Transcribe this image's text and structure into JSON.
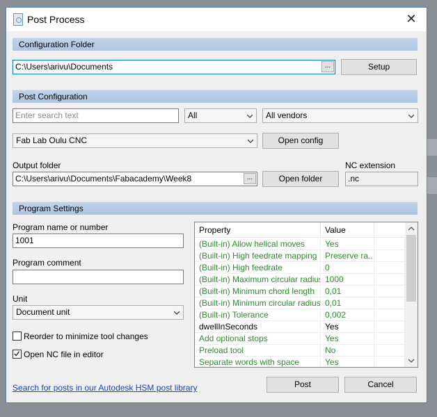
{
  "window": {
    "title": "Post Process"
  },
  "config_folder": {
    "header": "Configuration Folder",
    "path": "C:\\Users\\arivu\\Documents",
    "browse": "...",
    "setup_label": "Setup"
  },
  "post_config": {
    "header": "Post Configuration",
    "search_placeholder": "Enter search text",
    "filter_value": "All",
    "vendor_value": "All vendors",
    "post_value": "Fab Lab Oulu CNC",
    "open_config_label": "Open config",
    "output_folder_label": "Output folder",
    "output_path": "C:\\Users\\arivu\\Documents\\Fabacademy\\Week8",
    "browse": "...",
    "open_folder_label": "Open folder",
    "nc_extension_label": "NC extension",
    "nc_extension_value": ".nc"
  },
  "program_settings": {
    "header": "Program Settings",
    "name_label": "Program name or number",
    "name_value": "1001",
    "comment_label": "Program comment",
    "comment_value": "",
    "unit_label": "Unit",
    "unit_value": "Document unit",
    "reorder_label": "Reorder to minimize tool changes",
    "reorder_checked": false,
    "open_nc_label": "Open NC file in editor",
    "open_nc_checked": true
  },
  "properties": {
    "col_property": "Property",
    "col_value": "Value",
    "rows": [
      {
        "property": "(Built-in) Allow helical moves",
        "value": "Yes",
        "builtin": true
      },
      {
        "property": "(Built-in) High feedrate mapping",
        "value": "Preserve ra...",
        "builtin": true
      },
      {
        "property": "(Built-in) High feedrate",
        "value": "0",
        "builtin": true
      },
      {
        "property": "(Built-in) Maximum circular radius",
        "value": "1000",
        "builtin": true
      },
      {
        "property": "(Built-in) Minimum chord length",
        "value": "0,01",
        "builtin": true
      },
      {
        "property": "(Built-in) Minimum circular radius",
        "value": "0,01",
        "builtin": true
      },
      {
        "property": "(Built-in) Tolerance",
        "value": "0,002",
        "builtin": true
      },
      {
        "property": "dwellInSeconds",
        "value": "Yes",
        "builtin": false
      },
      {
        "property": "Add optional stops",
        "value": "Yes",
        "builtin": true
      },
      {
        "property": "Preload tool",
        "value": "No",
        "builtin": true
      },
      {
        "property": "Separate words with space",
        "value": "Yes",
        "builtin": true
      }
    ]
  },
  "footer": {
    "library_link": "Search for posts in our Autodesk HSM post library",
    "post_label": "Post",
    "cancel_label": "Cancel"
  },
  "colors": {
    "builtin_text": "#2e8b2e",
    "section_band": "#b8cbe6",
    "link": "#1a44b8"
  }
}
